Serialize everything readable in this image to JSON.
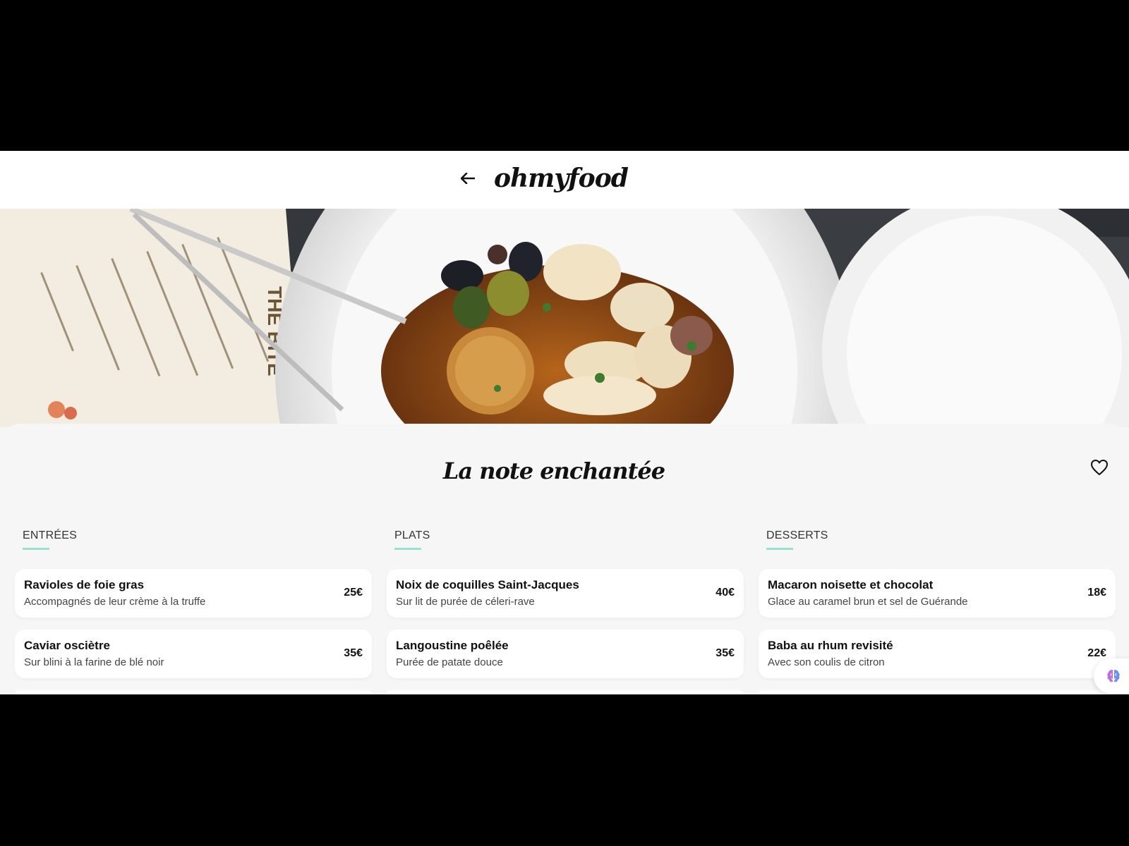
{
  "header": {
    "brand": "ohmyfood",
    "back_icon": "arrow-left-icon"
  },
  "hero": {
    "image": "photo of plated seafood dish with menu and tongs"
  },
  "restaurant": {
    "name": "La note enchantée",
    "favorite_icon": "heart-outline-icon"
  },
  "menu": {
    "columns": [
      {
        "heading": "ENTRÉES",
        "dishes": [
          {
            "name": "Ravioles de foie gras",
            "description": "Accompagnés de leur crème à la truffe",
            "price": "25€"
          },
          {
            "name": "Caviar osciètre",
            "description": "Sur blini à la farine de blé noir",
            "price": "35€"
          }
        ]
      },
      {
        "heading": "PLATS",
        "dishes": [
          {
            "name": "Noix de coquilles Saint-Jacques",
            "description": "Sur lit de purée de céleri-rave",
            "price": "40€"
          },
          {
            "name": "Langoustine poêlée",
            "description": "Purée de patate douce",
            "price": "35€"
          }
        ]
      },
      {
        "heading": "DESSERTS",
        "dishes": [
          {
            "name": "Macaron noisette et chocolat",
            "description": "Glace au caramel brun et sel de Guérande",
            "price": "18€"
          },
          {
            "name": "Baba au rhum revisité",
            "description": "Avec son coulis de citron",
            "price": "22€"
          }
        ]
      }
    ]
  },
  "colors": {
    "accent_underline": "#99e2d0",
    "card": "#ffffff",
    "page_bg": "#f6f6f6"
  },
  "widget": {
    "icon": "brain-icon"
  }
}
